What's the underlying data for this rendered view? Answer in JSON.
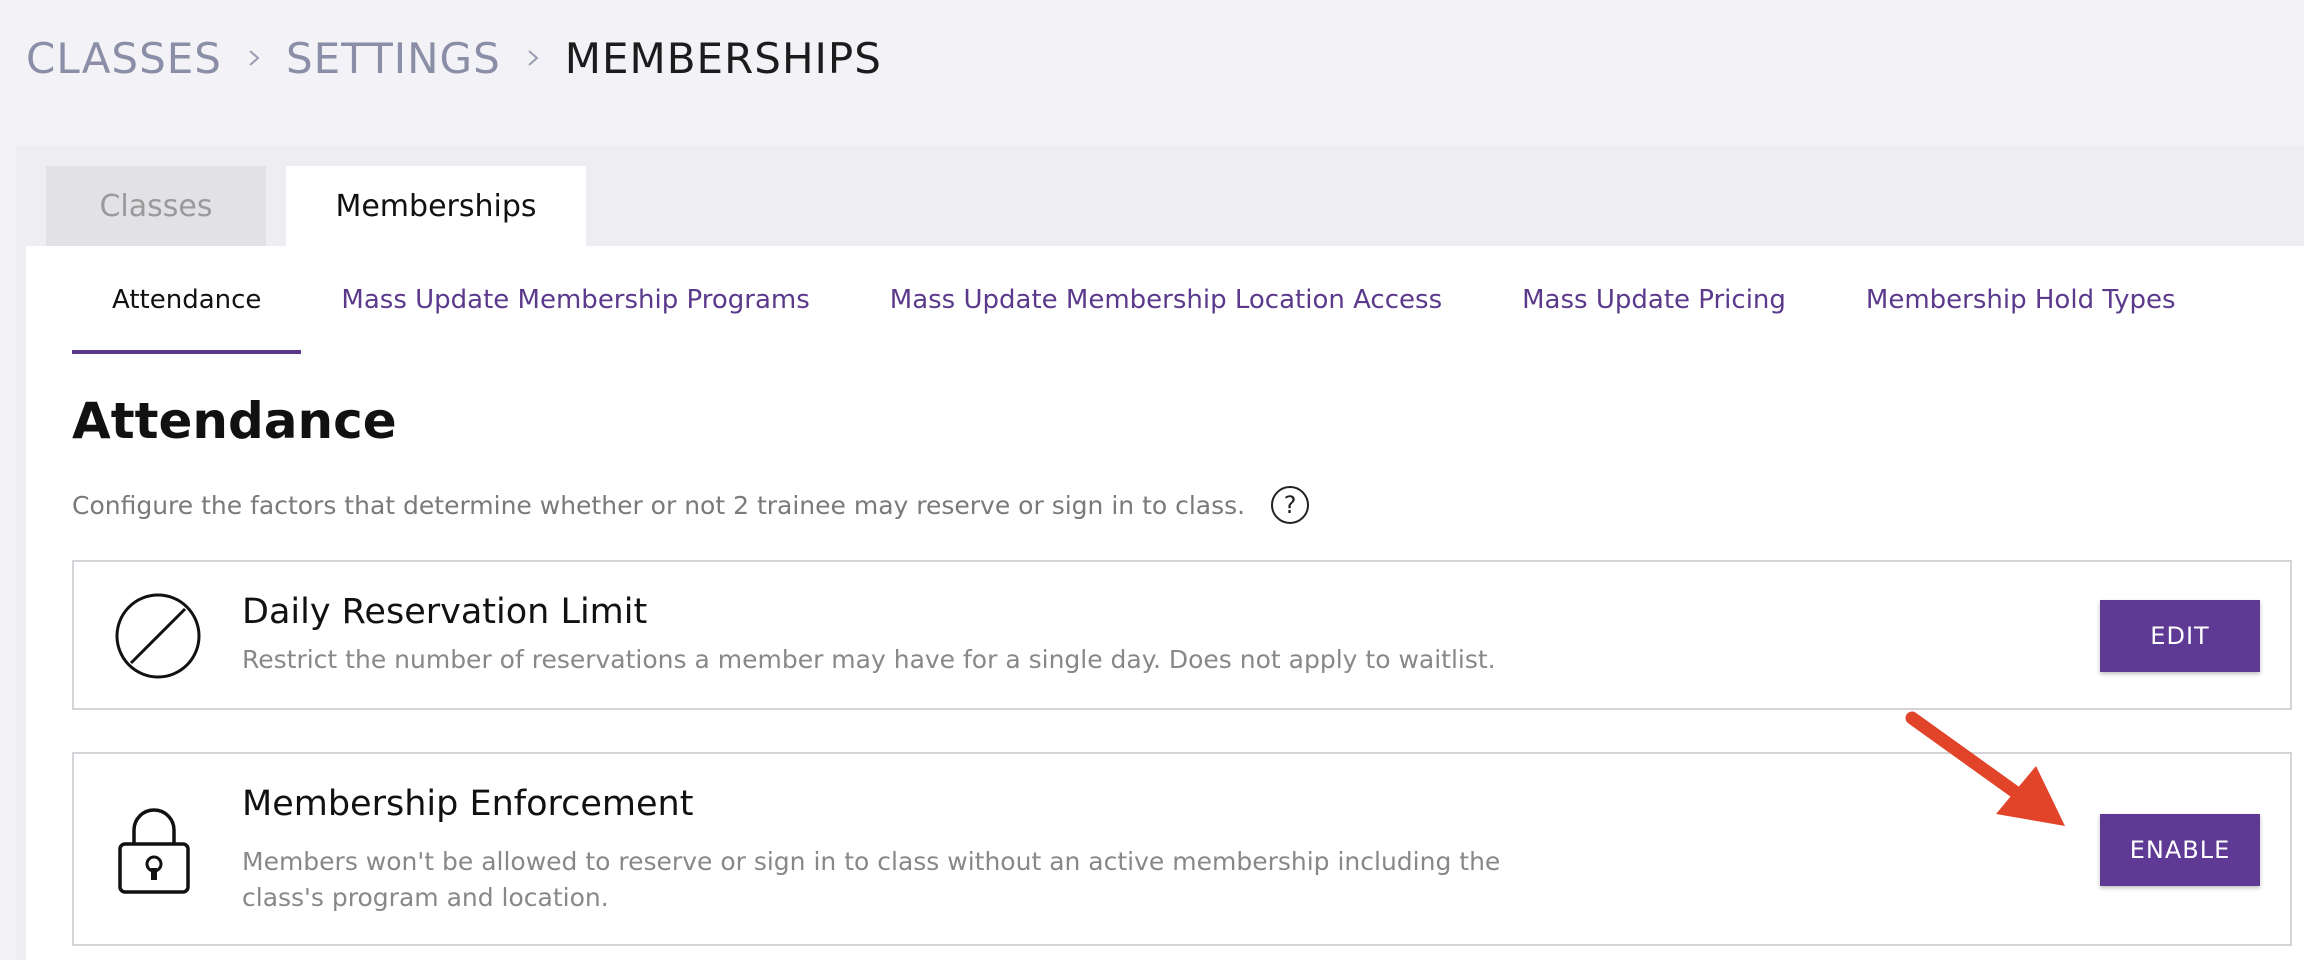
{
  "breadcrumb": {
    "items": [
      "CLASSES",
      "SETTINGS",
      "MEMBERSHIPS"
    ]
  },
  "top_tabs": [
    {
      "label": "Classes",
      "active": false
    },
    {
      "label": "Memberships",
      "active": true
    }
  ],
  "sub_tabs": [
    {
      "label": "Attendance",
      "active": true
    },
    {
      "label": "Mass Update Membership Programs",
      "active": false
    },
    {
      "label": "Mass Update Membership Location Access",
      "active": false
    },
    {
      "label": "Mass Update Pricing",
      "active": false
    },
    {
      "label": "Membership Hold Types",
      "active": false
    }
  ],
  "section": {
    "title": "Attendance",
    "description": "Configure the factors that determine whether or not 2 trainee may reserve or sign in to class.",
    "help_glyph": "?"
  },
  "cards": [
    {
      "icon": "no-entry-icon",
      "title": "Daily Reservation Limit",
      "description": "Restrict the number of reservations a member may have for a single day. Does not apply to waitlist.",
      "button_label": "EDIT"
    },
    {
      "icon": "lock-icon",
      "title": "Membership Enforcement",
      "description": "Members won't be allowed to reserve or sign in to class without an active membership including the class's program and location.",
      "button_label": "ENABLE"
    }
  ],
  "colors": {
    "accent": "#5e3a94",
    "link": "#5b3a8c",
    "annotation_arrow": "#e2442a"
  }
}
